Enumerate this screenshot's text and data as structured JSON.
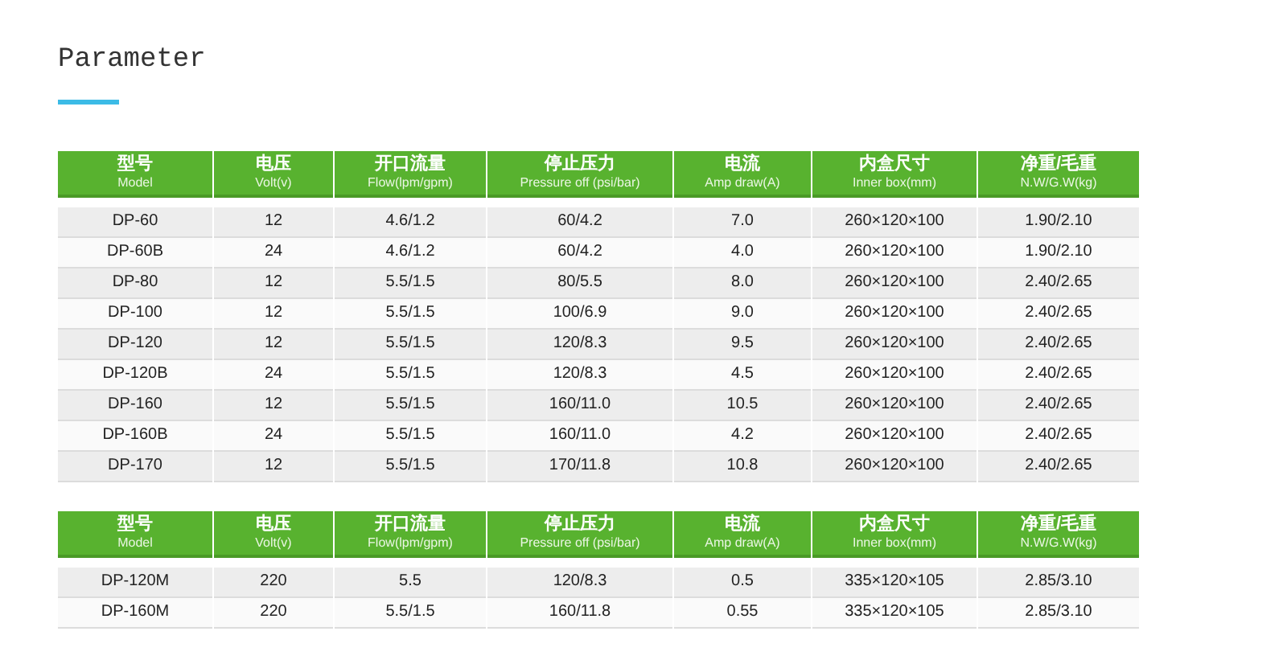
{
  "title": "Parameter",
  "tables": [
    {
      "columns": [
        {
          "zh": "型号",
          "en": "Model"
        },
        {
          "zh": "电压",
          "en": "Volt(v)"
        },
        {
          "zh": "开口流量",
          "en": "Flow(lpm/gpm)"
        },
        {
          "zh": "停止压力",
          "en": "Pressure off (psi/bar)"
        },
        {
          "zh": "电流",
          "en": "Amp draw(A)"
        },
        {
          "zh": "内盒尺寸",
          "en": "Inner box(mm)"
        },
        {
          "zh": "净重/毛重",
          "en": "N.W/G.W(kg)"
        }
      ],
      "rows": [
        [
          "DP-60",
          "12",
          "4.6/1.2",
          "60/4.2",
          "7.0",
          "260×120×100",
          "1.90/2.10"
        ],
        [
          "DP-60B",
          "24",
          "4.6/1.2",
          "60/4.2",
          "4.0",
          "260×120×100",
          "1.90/2.10"
        ],
        [
          "DP-80",
          "12",
          "5.5/1.5",
          "80/5.5",
          "8.0",
          "260×120×100",
          "2.40/2.65"
        ],
        [
          "DP-100",
          "12",
          "5.5/1.5",
          "100/6.9",
          "9.0",
          "260×120×100",
          "2.40/2.65"
        ],
        [
          "DP-120",
          "12",
          "5.5/1.5",
          "120/8.3",
          "9.5",
          "260×120×100",
          "2.40/2.65"
        ],
        [
          "DP-120B",
          "24",
          "5.5/1.5",
          "120/8.3",
          "4.5",
          "260×120×100",
          "2.40/2.65"
        ],
        [
          "DP-160",
          "12",
          "5.5/1.5",
          "160/11.0",
          "10.5",
          "260×120×100",
          "2.40/2.65"
        ],
        [
          "DP-160B",
          "24",
          "5.5/1.5",
          "160/11.0",
          "4.2",
          "260×120×100",
          "2.40/2.65"
        ],
        [
          "DP-170",
          "12",
          "5.5/1.5",
          "170/11.8",
          "10.8",
          "260×120×100",
          "2.40/2.65"
        ]
      ]
    },
    {
      "columns": [
        {
          "zh": "型号",
          "en": "Model"
        },
        {
          "zh": "电压",
          "en": "Volt(v)"
        },
        {
          "zh": "开口流量",
          "en": "Flow(lpm/gpm)"
        },
        {
          "zh": "停止压力",
          "en": "Pressure off (psi/bar)"
        },
        {
          "zh": "电流",
          "en": "Amp draw(A)"
        },
        {
          "zh": "内盒尺寸",
          "en": "Inner box(mm)"
        },
        {
          "zh": "净重/毛重",
          "en": "N.W/G.W(kg)"
        }
      ],
      "rows": [
        [
          "DP-120M",
          "220",
          "5.5",
          "120/8.3",
          "0.5",
          "335×120×105",
          "2.85/3.10"
        ],
        [
          "DP-160M",
          "220",
          "5.5/1.5",
          "160/11.8",
          "0.55",
          "335×120×105",
          "2.85/3.10"
        ]
      ]
    }
  ]
}
